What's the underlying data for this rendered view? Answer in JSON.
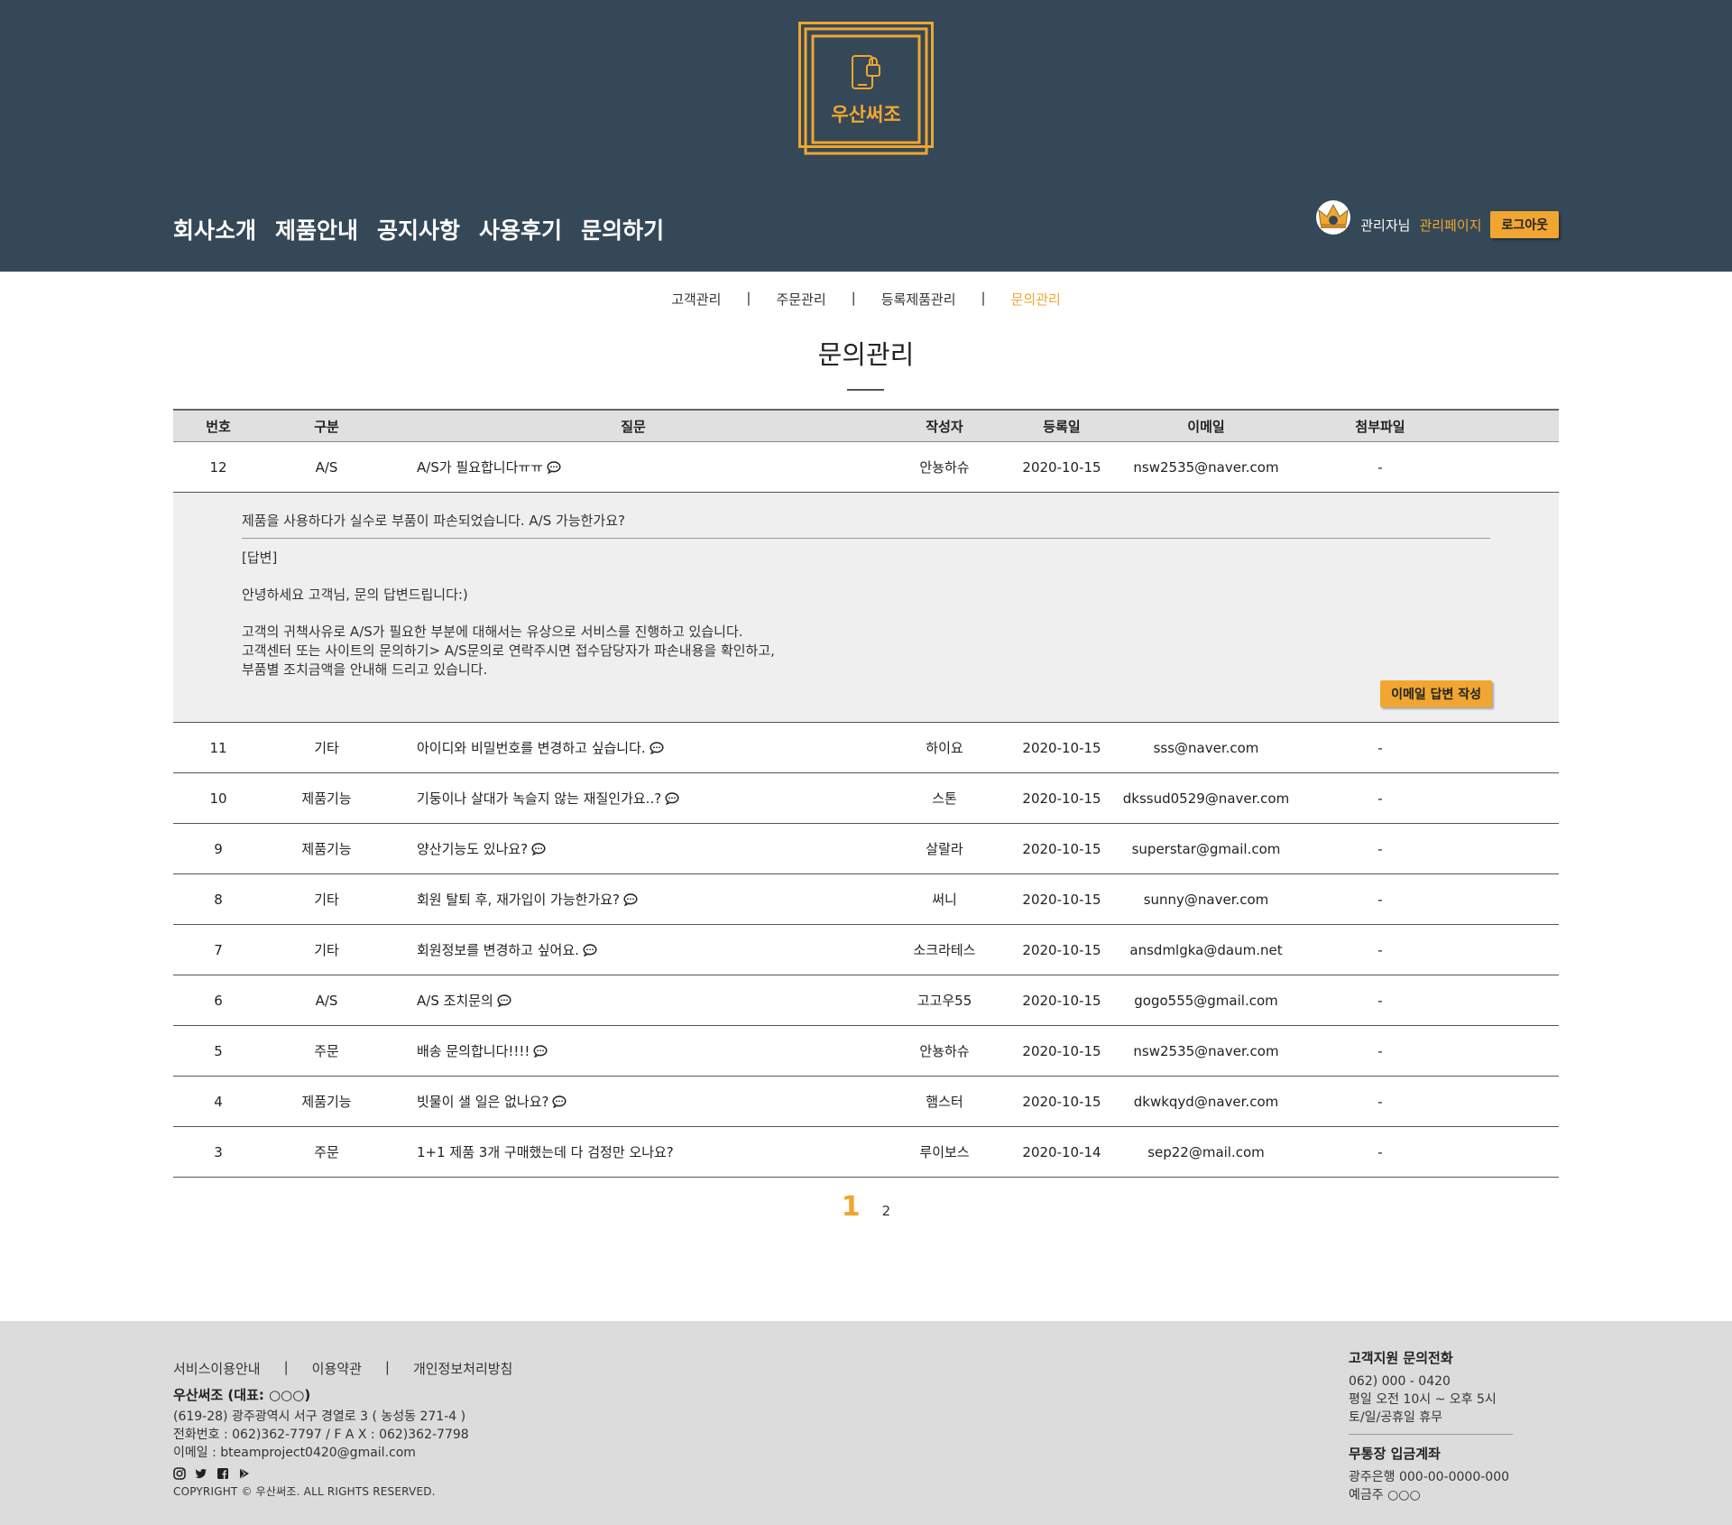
{
  "header": {
    "logo_text": "우산써조",
    "nav": [
      "회사소개",
      "제품안내",
      "공지사항",
      "사용후기",
      "문의하기"
    ],
    "user_name": "관리자님",
    "admin_link": "관리페이지",
    "logout": "로그아웃",
    "accent": "#f0a630",
    "bg": "#354857"
  },
  "subnav": {
    "items": [
      "고객관리",
      "주문관리",
      "등록제품관리",
      "문의관리"
    ],
    "active": "문의관리",
    "separator": "|"
  },
  "page_title": "문의관리",
  "table": {
    "headers": {
      "no": "번호",
      "cat": "구분",
      "q": "질문",
      "writer": "작성자",
      "date": "등록일",
      "email": "이메일",
      "file": "첨부파일"
    },
    "rows": [
      {
        "no": "12",
        "cat": "A/S",
        "q": "A/S가 필요합니다ㅠㅠ",
        "icon": "chat-bubble-icon",
        "writer": "안뇽하슈",
        "date": "2020-10-15",
        "email": "nsw2535@naver.com",
        "file": "-"
      },
      {
        "no": "11",
        "cat": "기타",
        "q": "아이디와 비밀번호를 변경하고 싶습니다.",
        "icon": "chat-bubble-icon",
        "writer": "하이요",
        "date": "2020-10-15",
        "email": "sss@naver.com",
        "file": "-"
      },
      {
        "no": "10",
        "cat": "제품기능",
        "q": "기둥이나 살대가 녹슬지 않는 재질인가요..?",
        "icon": "chat-bubble-icon",
        "writer": "스톤",
        "date": "2020-10-15",
        "email": "dkssud0529@naver.com",
        "file": "-"
      },
      {
        "no": "9",
        "cat": "제품기능",
        "q": "양산기능도 있나요?",
        "icon": "chat-bubble-icon",
        "writer": "살랄라",
        "date": "2020-10-15",
        "email": "superstar@gmail.com",
        "file": "-"
      },
      {
        "no": "8",
        "cat": "기타",
        "q": "회원 탈퇴 후, 재가입이 가능한가요?",
        "icon": "chat-bubble-icon",
        "writer": "써니",
        "date": "2020-10-15",
        "email": "sunny@naver.com",
        "file": "-"
      },
      {
        "no": "7",
        "cat": "기타",
        "q": "회원정보를 변경하고 싶어요.",
        "icon": "chat-bubble-icon",
        "writer": "소크라테스",
        "date": "2020-10-15",
        "email": "ansdmlgka@daum.net",
        "file": "-"
      },
      {
        "no": "6",
        "cat": "A/S",
        "q": "A/S 조치문의",
        "icon": "chat-bubble-icon",
        "writer": "고고우55",
        "date": "2020-10-15",
        "email": "gogo555@gmail.com",
        "file": "-"
      },
      {
        "no": "5",
        "cat": "주문",
        "q": "배송 문의합니다!!!!",
        "icon": "chat-bubble-icon",
        "writer": "안뇽하슈",
        "date": "2020-10-15",
        "email": "nsw2535@naver.com",
        "file": "-"
      },
      {
        "no": "4",
        "cat": "제품기능",
        "q": "빗물이 샐 일은 없나요?",
        "icon": "chat-bubble-icon",
        "writer": "햄스터",
        "date": "2020-10-15",
        "email": "dkwkqyd@naver.com",
        "file": "-"
      },
      {
        "no": "3",
        "cat": "주문",
        "q": "1+1 제품 3개 구매했는데 다 검정만 오나요?",
        "icon": "",
        "writer": "루이보스",
        "date": "2020-10-14",
        "email": "sep22@mail.com",
        "file": "-"
      }
    ],
    "detail": {
      "question": "제품을 사용하다가 실수로 부품이 파손되었습니다. A/S 가능한가요?",
      "answer_label": "[답변]",
      "greeting": "안녕하세요 고객님, 문의 답변드립니다:)",
      "lines": [
        "고객의 귀책사유로 A/S가 필요한 부분에 대해서는 유상으로 서비스를 진행하고 있습니다.",
        "고객센터 또는 사이트의 문의하기> A/S문의로 연락주시면 접수담당자가 파손내용을 확인하고,",
        "부품별 조치금액을 안내해 드리고 있습니다."
      ],
      "email_button": "이메일 답변 작성"
    }
  },
  "pagination": {
    "current": "1",
    "pages": [
      "2"
    ]
  },
  "footer": {
    "links": [
      "서비스이용안내",
      "이용약관",
      "개인정보처리방침"
    ],
    "company": "우산써조 (대표: ○○○)",
    "address": "(619-28) 광주광역시 서구 경열로 3 ( 농성동 271-4 )",
    "phone": "전화번호 : 062)362-7797 / F A X : 062)362-7798",
    "email": "이메일 : bteamproject0420@gmail.com",
    "social_icons": [
      "instagram-icon",
      "twitter-icon",
      "facebook-icon",
      "play-store-icon"
    ],
    "copyright": "COPYRIGHT © 우산써조. ALL RIGHTS RESERVED.",
    "cs_title": "고객지원 문의전화",
    "cs_lines": [
      "062) 000 - 0420",
      "평일 오전 10시 ~ 오후 5시",
      "토/일/공휴일 휴무"
    ],
    "bank_title": "무통장 입금계좌",
    "bank_lines": [
      "광주은행 000-00-0000-000",
      "예금주 ○○○"
    ]
  }
}
